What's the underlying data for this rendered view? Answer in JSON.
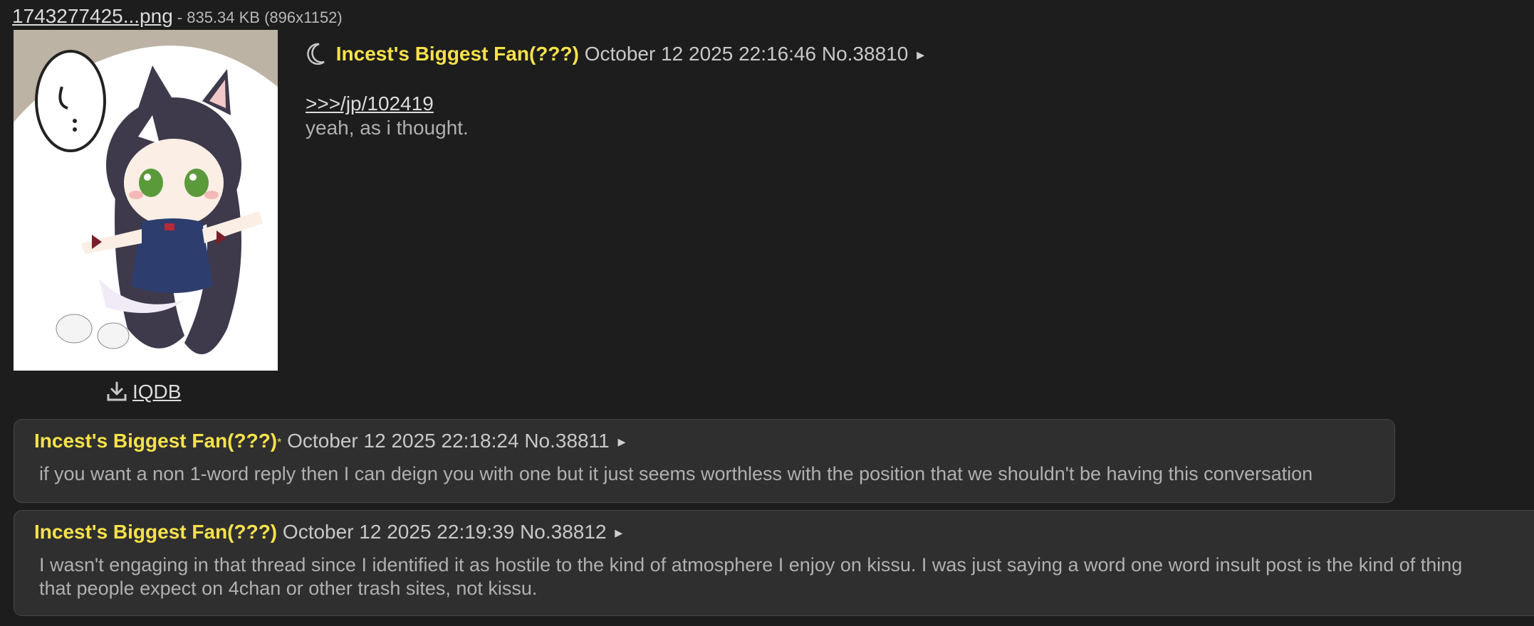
{
  "file": {
    "name": "1743277425...png",
    "meta": "- 835.34 KB (896x1152)"
  },
  "iqdb": {
    "label": "IQDB"
  },
  "op": {
    "name": "Incest's Biggest Fan(???)",
    "date": "October 12 2025 22:16:46",
    "post_no": "No.38810",
    "arrow": "▸",
    "quote": ">>>/jp/102419",
    "body": "yeah, as i thought."
  },
  "replies": [
    {
      "name": "Incest's Biggest Fan(???)",
      "star": "*",
      "date": "October 12 2025 22:18:24",
      "post_no": "No.38811",
      "arrow": "▸",
      "body": "if you want a non 1-word reply then I can deign you with one but it just seems worthless with the position that we shouldn't be having this conversation"
    },
    {
      "name": "Incest's Biggest Fan(???)",
      "date": "October 12 2025 22:19:39",
      "post_no": "No.38812",
      "arrow": "▸",
      "body": "I wasn't engaging in that thread since I identified it as hostile to the kind of atmosphere I enjoy on kissu. I was just saying a word one word insult post is the kind of thing that people expect on 4chan or other trash sites, not kissu."
    }
  ],
  "colors": {
    "background": "#1d1d1d",
    "name": "#f7e24a",
    "reply_bg": "#2f2f2f",
    "text": "#b0b0b0"
  },
  "icons": {
    "moon": "moon-icon",
    "download": "download-icon",
    "arrow": "arrow-right-icon"
  }
}
